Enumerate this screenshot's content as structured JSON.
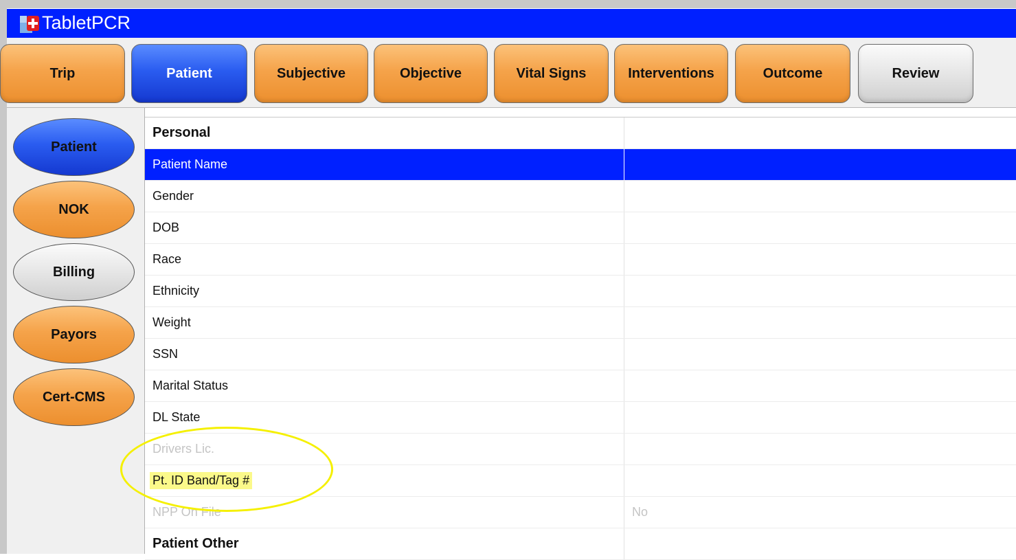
{
  "window": {
    "title": "TabletPCR",
    "icon": "tabletpcr-app-icon"
  },
  "top_tabs": [
    {
      "label": "Trip",
      "style": "orange"
    },
    {
      "label": "Patient",
      "style": "blue",
      "selected": true
    },
    {
      "label": "Subjective",
      "style": "orange"
    },
    {
      "label": "Objective",
      "style": "orange"
    },
    {
      "label": "Vital Signs",
      "style": "orange"
    },
    {
      "label": "Interventions",
      "style": "orange"
    },
    {
      "label": "Outcome",
      "style": "orange"
    },
    {
      "label": "Review",
      "style": "gray"
    }
  ],
  "side_nav": [
    {
      "label": "Patient",
      "style": "blue",
      "selected": true
    },
    {
      "label": "NOK",
      "style": "orange"
    },
    {
      "label": "Billing",
      "style": "gray"
    },
    {
      "label": "Payors",
      "style": "orange"
    },
    {
      "label": "Cert-CMS",
      "style": "orange"
    }
  ],
  "grid": {
    "rows": [
      {
        "label": "Personal",
        "value": "",
        "type": "header"
      },
      {
        "label": "Patient Name",
        "value": "",
        "type": "field",
        "selected": true
      },
      {
        "label": "Gender",
        "value": "",
        "type": "field"
      },
      {
        "label": "DOB",
        "value": "",
        "type": "field"
      },
      {
        "label": "Race",
        "value": "",
        "type": "field"
      },
      {
        "label": "Ethnicity",
        "value": "",
        "type": "field"
      },
      {
        "label": "Weight",
        "value": "",
        "type": "field"
      },
      {
        "label": "SSN",
        "value": "",
        "type": "field"
      },
      {
        "label": "Marital Status",
        "value": "",
        "type": "field"
      },
      {
        "label": "DL State",
        "value": "",
        "type": "field"
      },
      {
        "label": "Drivers Lic.",
        "value": "",
        "type": "field",
        "disabled": true
      },
      {
        "label": "Pt. ID Band/Tag #",
        "value": "",
        "type": "field",
        "highlighted": true
      },
      {
        "label": "NPP On File",
        "value": "No",
        "type": "field",
        "disabled": true
      },
      {
        "label": "Patient Other",
        "value": "",
        "type": "header"
      }
    ]
  },
  "colors": {
    "title_bar": "#0020ff",
    "selected_row": "#0020ff",
    "orange_button": "#f5a34a",
    "blue_button": "#2a5cf0",
    "highlight": "#fbf98a",
    "annotation_ellipse": "#f5f000"
  }
}
